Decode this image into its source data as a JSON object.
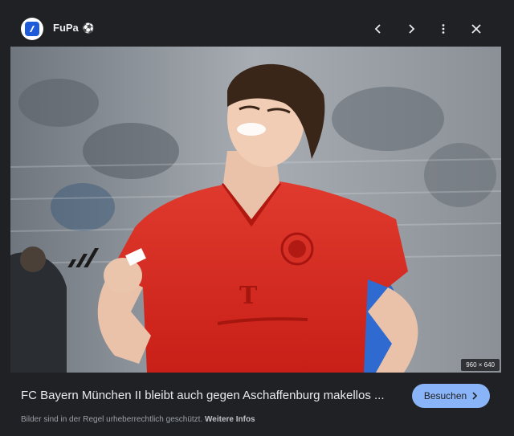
{
  "header": {
    "site_name": "FuPa",
    "site_emoji": "⚽",
    "icons": [
      "fupa-logo-icon",
      "soccer-ball-icon",
      "chevron-left-icon",
      "chevron-right-icon",
      "more-vert-icon",
      "close-icon"
    ]
  },
  "image": {
    "dimensions": "960 × 640",
    "jersey_sponsor": "T"
  },
  "footer": {
    "title": "FC Bayern München II bleibt auch gegen Aschaffenburg makellos ...",
    "visit_label": "Besuchen",
    "copyright_text": "Bilder sind in der Regel urheberrechtlich geschützt.",
    "more_info_label": "Weitere Infos"
  },
  "colors": {
    "background": "#202124",
    "accent": "#8ab4f8",
    "jersey": "#d9261c",
    "text": "#e8eaed"
  }
}
